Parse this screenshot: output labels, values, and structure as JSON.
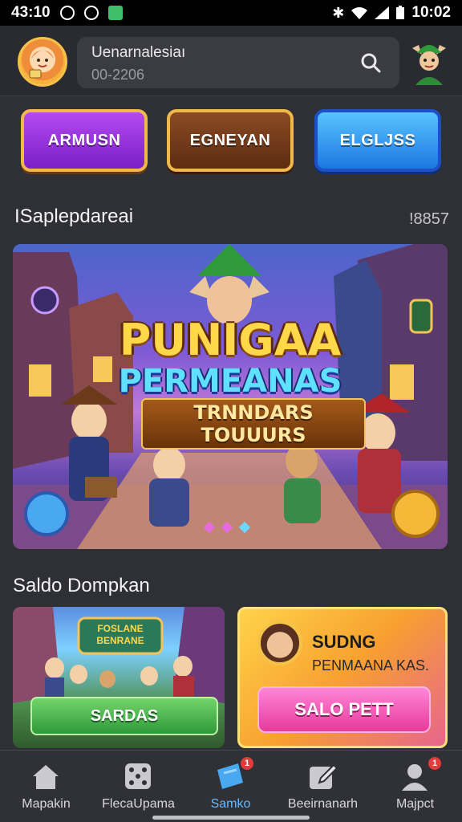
{
  "status_bar": {
    "time_left": "43:10",
    "time_right": "10:02",
    "icons": [
      "globe-icon",
      "clock-icon",
      "mail-icon",
      "bluetooth-icon",
      "wifi-icon",
      "signal-icon",
      "battery-icon"
    ]
  },
  "header": {
    "search_title": "Uenarnalesiaı",
    "search_subtitle": "00-2206",
    "search_icon": "search-icon"
  },
  "categories": [
    {
      "label": "ARMUSN",
      "color": "#9a34e0"
    },
    {
      "label": "EGNEYAN",
      "color": "#7a3d1c"
    },
    {
      "label": "ELGLJSS",
      "color": "#2b8bf0"
    }
  ],
  "featured": {
    "section_title": "ISaplepdareai",
    "count": "!8857",
    "banner": {
      "title_line1": "PUNIGAA",
      "title_line2": "PERMEANAS",
      "title_line3": "TRNNDARS TOUUURS"
    }
  },
  "second_section": {
    "title": "Saldo Dompkan",
    "card_left": {
      "logo_text": "FOSLANE BENRANE",
      "button_label": "SARDAS"
    },
    "card_right": {
      "title": "SUDNG",
      "subtitle": "PENMAANA KAS.",
      "button_label": "SALO PETT"
    }
  },
  "bottom_nav": {
    "items": [
      {
        "label": "Mapakin",
        "icon": "home-icon",
        "badge": ""
      },
      {
        "label": "FlecaUpama",
        "icon": "dice-icon",
        "badge": ""
      },
      {
        "label": "Samko",
        "icon": "ticket-icon",
        "badge": "1",
        "active": true
      },
      {
        "label": "Beeirnanarh",
        "icon": "edit-icon",
        "badge": ""
      },
      {
        "label": "Majpct",
        "icon": "profile-icon",
        "badge": "1"
      }
    ]
  },
  "colors": {
    "background": "#2f3035",
    "accent_blue": "#68b9ff",
    "badge_red": "#e33b3b"
  }
}
